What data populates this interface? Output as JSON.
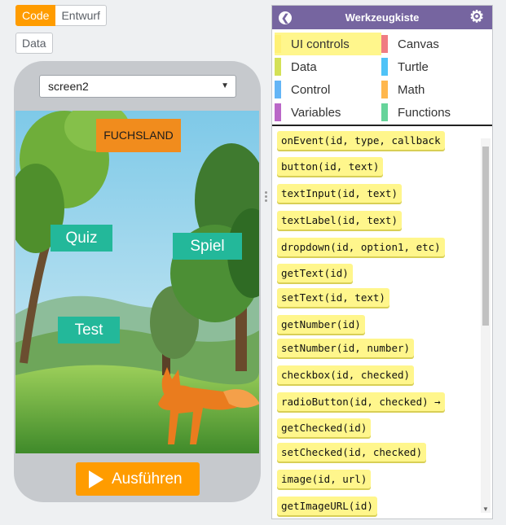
{
  "mode_toggle": {
    "code": "Code",
    "design": "Entwurf"
  },
  "data_button": "Data",
  "screen_select": {
    "value": "screen2"
  },
  "app": {
    "title_label": "FUCHSLAND",
    "buttons": {
      "quiz": "Quiz",
      "spiel": "Spiel",
      "test": "Test"
    }
  },
  "run_button": "Ausführen",
  "toolbox": {
    "title": "Werkzeugkiste",
    "categories": [
      {
        "label": "UI controls",
        "color": "#fff176",
        "selected": true
      },
      {
        "label": "Canvas",
        "color": "#f07c82"
      },
      {
        "label": "Data",
        "color": "#d4e157"
      },
      {
        "label": "Turtle",
        "color": "#4fc3f7"
      },
      {
        "label": "Control",
        "color": "#64b5f6"
      },
      {
        "label": "Math",
        "color": "#ffb74d"
      },
      {
        "label": "Variables",
        "color": "#ba68c8"
      },
      {
        "label": "Functions",
        "color": "#66d49a"
      }
    ],
    "blocks": [
      "onEvent(id, type, callback",
      "button(id, text)",
      "textInput(id, text)",
      "textLabel(id, text)",
      "dropdown(id, option1, etc)",
      "getText(id)",
      "setText(id, text)",
      "getNumber(id)",
      "setNumber(id, number)",
      "checkbox(id, checked)",
      "radioButton(id, checked) →",
      "getChecked(id)",
      "setChecked(id, checked)",
      "image(id, url)",
      "getImageURL(id)"
    ]
  },
  "colors": {
    "accent": "#ff9c00",
    "toolbox_header": "#7665a0",
    "app_button": "#23b89a",
    "title_label": "#f18c1d"
  }
}
